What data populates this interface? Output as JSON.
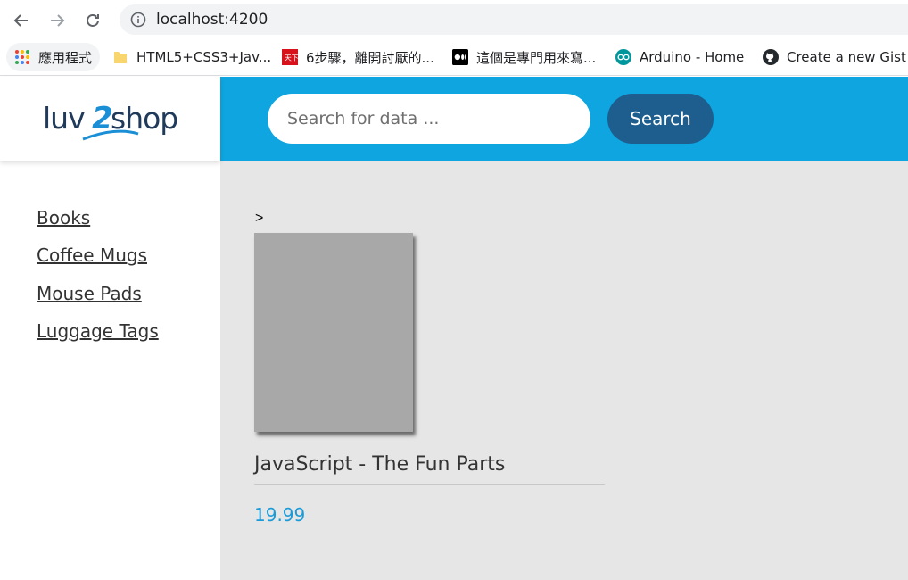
{
  "browser": {
    "url": "localhost:4200",
    "bookmarks": [
      {
        "label": "應用程式",
        "icon": "apps-grid-icon"
      },
      {
        "label": "HTML5+CSS3+Jav...",
        "icon": "folder-icon"
      },
      {
        "label": "6步驟，離開討厭的...",
        "icon": "site-red-icon"
      },
      {
        "label": "這個是專門用來寫...",
        "icon": "medium-icon"
      },
      {
        "label": "Arduino - Home",
        "icon": "arduino-icon"
      },
      {
        "label": "Create a new Gist",
        "icon": "github-icon"
      }
    ]
  },
  "app": {
    "logo": {
      "part1": "luv",
      "part2": "2",
      "part3": "shop"
    },
    "search": {
      "placeholder": "Search for data ...",
      "button_label": "Search"
    },
    "categories": [
      {
        "label": "Books"
      },
      {
        "label": "Coffee Mugs"
      },
      {
        "label": "Mouse Pads"
      },
      {
        "label": "Luggage Tags"
      }
    ],
    "content": {
      "stray_text": ">",
      "products": [
        {
          "name": "JavaScript - The Fun Parts",
          "price": "19.99"
        }
      ]
    }
  },
  "colors": {
    "header": "#0ea5e0",
    "search_button": "#1d5e8e",
    "price": "#1a9ad6",
    "content_bg": "#e6e6e6"
  }
}
